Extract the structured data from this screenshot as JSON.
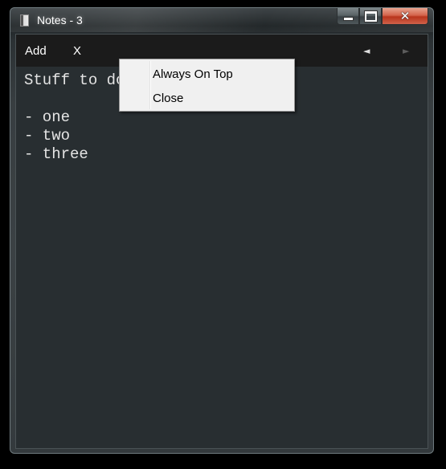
{
  "window": {
    "title": "Notes - 3",
    "close_glyph": "✕"
  },
  "toolbar": {
    "add_label": "Add",
    "delete_label": "X",
    "prev_glyph": "◄",
    "next_glyph": "►"
  },
  "note": {
    "text": "Stuff to do:\n\n- one\n- two\n- three"
  },
  "context_menu": {
    "items": [
      {
        "label": "Always On Top"
      },
      {
        "label": "Close"
      }
    ]
  },
  "colors": {
    "note_background": "#282e31",
    "toolbar_background": "#1b1b1b",
    "text": "#e4e4e4",
    "close_button": "#c7432b"
  }
}
